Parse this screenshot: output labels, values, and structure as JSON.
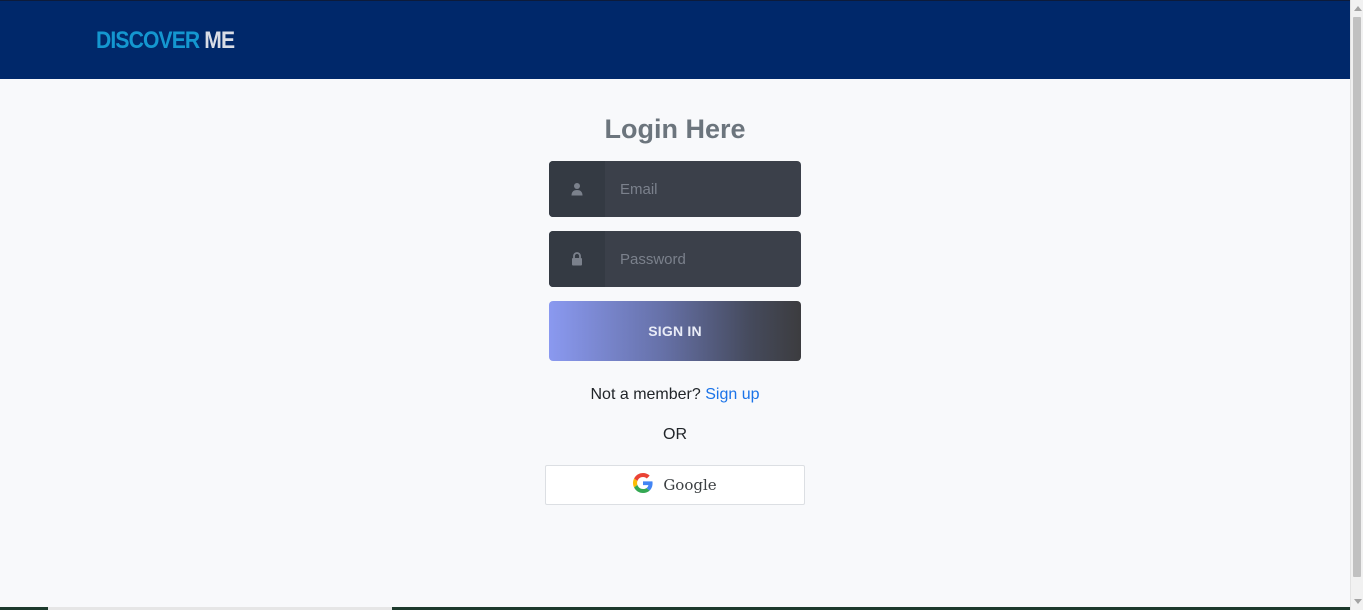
{
  "navbar": {
    "brand_part1": "DISCOVER",
    "brand_part2": "ME",
    "brand_color1": "#1497d0",
    "brand_color2": "#d9dde6",
    "background": "#00286a"
  },
  "login": {
    "title": "Login Here",
    "email": {
      "placeholder": "Email",
      "value": "",
      "icon": "user-icon"
    },
    "password": {
      "placeholder": "Password",
      "value": "",
      "icon": "lock-icon"
    },
    "signin_label": "SIGN IN",
    "member_text": "Not a member?",
    "signup_link": "Sign up",
    "link_color": "#1a73e8",
    "or_text": "OR",
    "google_label": "Google",
    "google_icon": "google-icon"
  }
}
